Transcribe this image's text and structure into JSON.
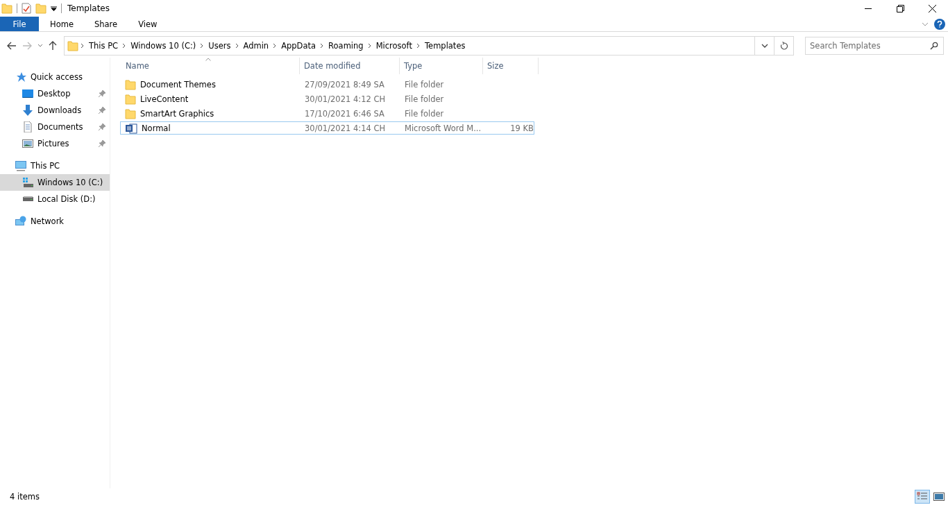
{
  "window": {
    "title": "Templates"
  },
  "ribbon_tabs": [
    {
      "label": "File",
      "selected": true
    },
    {
      "label": "Home",
      "selected": false
    },
    {
      "label": "Share",
      "selected": false
    },
    {
      "label": "View",
      "selected": false
    }
  ],
  "breadcrumb": [
    "This PC",
    "Windows 10 (C:)",
    "Users",
    "Admin",
    "AppData",
    "Roaming",
    "Microsoft",
    "Templates"
  ],
  "search": {
    "placeholder": "Search Templates"
  },
  "sidebar": {
    "groups": [
      {
        "label": "Quick access",
        "kind": "star",
        "selected": false,
        "children": [
          {
            "label": "Desktop",
            "kind": "desktop",
            "pinned": true,
            "selected": false
          },
          {
            "label": "Downloads",
            "kind": "download",
            "pinned": true,
            "selected": false
          },
          {
            "label": "Documents",
            "kind": "document",
            "pinned": true,
            "selected": false
          },
          {
            "label": "Pictures",
            "kind": "pictures",
            "pinned": true,
            "selected": false
          }
        ]
      },
      {
        "label": "This PC",
        "kind": "pc",
        "selected": false,
        "children": [
          {
            "label": "Windows 10 (C:)",
            "kind": "windows-drive",
            "pinned": false,
            "selected": true
          },
          {
            "label": "Local Disk (D:)",
            "kind": "drive",
            "pinned": false,
            "selected": false
          }
        ]
      },
      {
        "label": "Network",
        "kind": "network",
        "selected": false
      }
    ]
  },
  "table": {
    "columns": [
      "Name",
      "Date modified",
      "Type",
      "Size"
    ],
    "rows": [
      {
        "name": "Document Themes",
        "date": "27/09/2021 8:49 SA",
        "type": "File folder",
        "kind": "folder",
        "focused": false
      },
      {
        "name": "LiveContent",
        "date": "30/01/2021 4:12 CH",
        "type": "File folder",
        "kind": "folder",
        "focused": false
      },
      {
        "name": "SmartArt Graphics",
        "date": "17/10/2021 6:46 SA",
        "type": "File folder",
        "kind": "folder",
        "focused": false
      },
      {
        "name": "Normal",
        "date": "30/01/2021 4:14 CH",
        "type": "Microsoft Word M...",
        "size": "19 KB",
        "kind": "word",
        "focused": true
      }
    ]
  },
  "status_bar": {
    "count": "4 items",
    "views": [
      {
        "kind": "details",
        "selected": true
      },
      {
        "kind": "large-icons",
        "selected": false
      }
    ]
  }
}
